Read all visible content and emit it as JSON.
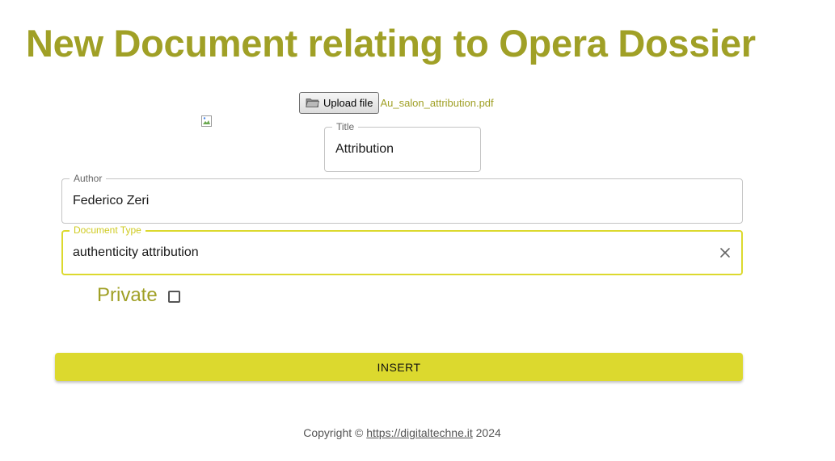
{
  "page": {
    "title": "New Document relating to Opera Dossier",
    "accent_color": "#a0a026",
    "button_color": "#dcd92e"
  },
  "upload": {
    "button_label": "Upload file",
    "file_name": "Au_salon_attribution.pdf",
    "icon": "folder-icon"
  },
  "form": {
    "title": {
      "label": "Title",
      "value": "Attribution"
    },
    "author": {
      "label": "Author",
      "value": "Federico Zeri"
    },
    "document_type": {
      "label": "Document Type",
      "value": "authenticity attribution",
      "clear_icon": "close-icon"
    },
    "private": {
      "label": "Private",
      "checked": false
    },
    "submit_label": "INSERT"
  },
  "footer": {
    "prefix": "Copyright ©",
    "link_text": "https://digitaltechne.it",
    "year": "2024"
  }
}
